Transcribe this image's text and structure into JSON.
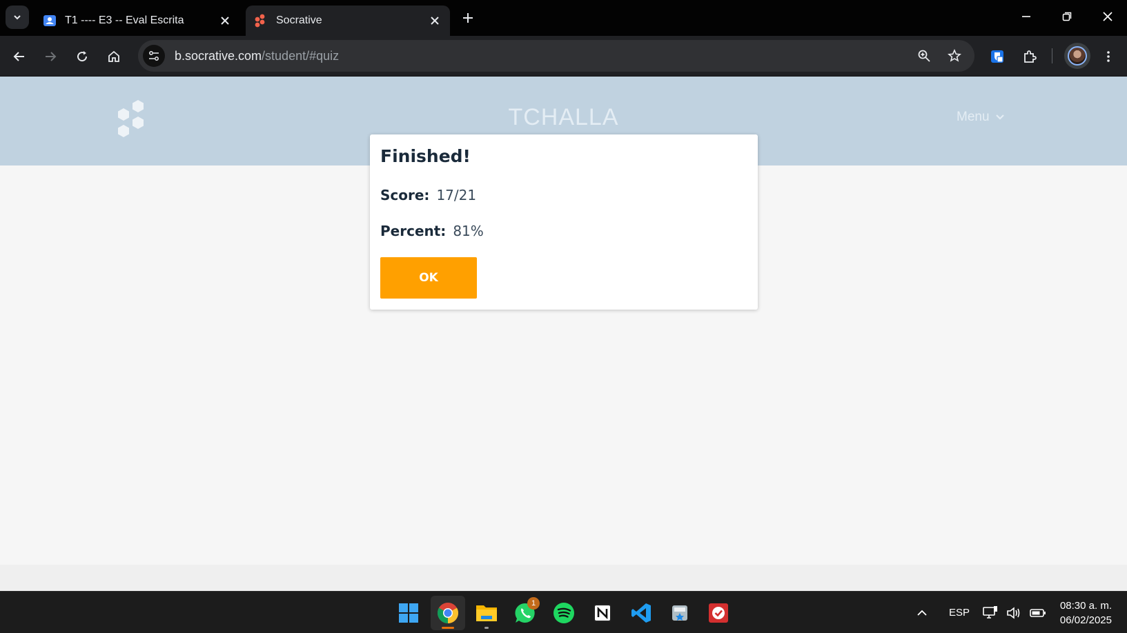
{
  "browser": {
    "tabs": [
      {
        "title": "T1 ---- E3 -- Eval Escrita",
        "icon": "classroom-icon",
        "active": false
      },
      {
        "title": "Socrative",
        "icon": "socrative-icon",
        "active": true
      }
    ],
    "url_host": "b.socrative.com",
    "url_path": "/student/#quiz"
  },
  "page": {
    "room_name": "TCHALLA",
    "menu_label": "Menu"
  },
  "modal": {
    "title": "Finished!",
    "score_label": "Score:",
    "score_value": "17/21",
    "percent_label": "Percent:",
    "percent_value": "81%",
    "ok_label": "OK"
  },
  "taskbar": {
    "apps": [
      "start",
      "chrome",
      "file-explorer",
      "whatsapp",
      "spotify",
      "notion",
      "vscode",
      "app",
      "todo"
    ],
    "whatsapp_badge": "1",
    "language": "ESP",
    "time": "08:30 a. m.",
    "date": "06/02/2025"
  },
  "colors": {
    "header_bg": "#c0d2e0",
    "ok_button": "#ffa000",
    "socrative_accent": "#f2624b"
  }
}
